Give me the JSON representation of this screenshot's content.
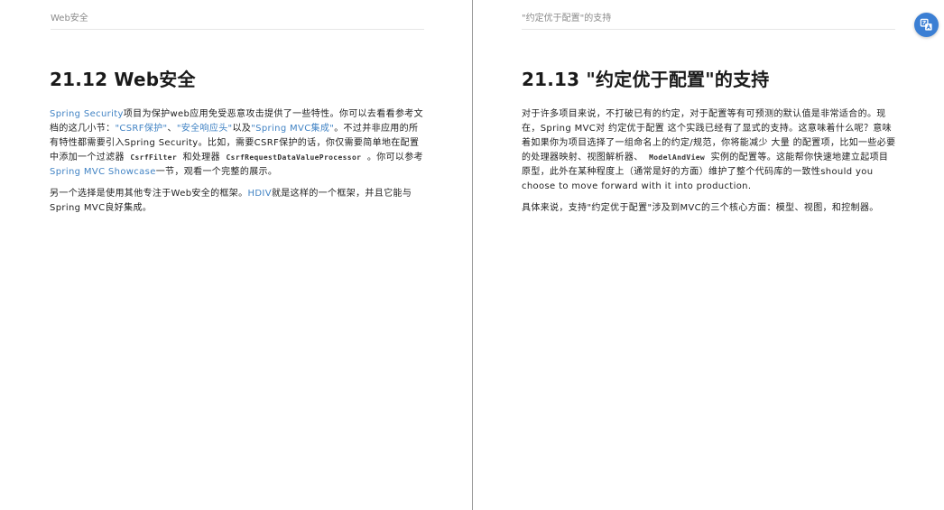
{
  "left_page": {
    "running_head": "Web安全",
    "title": "21.12 Web安全",
    "p1": {
      "link_spring_security": "Spring Security",
      "t1": "项目为保护web应用免受恶意攻击提供了一些特性。你可以去看看参考文档的这几小节：",
      "link_csrf": "\"CSRF保护\"",
      "t2": "、",
      "link_headers": "\"安全响应头\"",
      "t3": "以及",
      "link_mvc_integration": "\"Spring MVC集成\"",
      "t4": "。不过并非应用的所有特性都需要引入Spring Security。比如，需要CSRF保护的话，你仅需要简单地在配置中添加一个过滤器 ",
      "code_filter": "CsrfFilter",
      "t5": " 和处理器 ",
      "code_processor": "CsrfRequestDataValueProcessor",
      "t6": " 。你可以参考",
      "link_showcase": "Spring MVC Showcase",
      "t7": "一节，观看一个完整的展示。"
    },
    "p2": {
      "t1": "另一个选择是使用其他专注于Web安全的框架。",
      "link_hdiv": "HDIV",
      "t2": "就是这样的一个框架，并且它能与Spring MVC良好集成。"
    }
  },
  "right_page": {
    "running_head": "\"约定优于配置\"的支持",
    "title": "21.13 \"约定优于配置\"的支持",
    "p1": {
      "t1": "对于许多项目来说，不打破已有的约定，对于配置等有可预测的默认值是非常适合的。现在，Spring MVC对 约定优于配置 这个实践已经有了显式的支持。这意味着什么呢？意味着如果你为项目选择了一组命名上的约定/规范，你将能减少 大量 的配置项，比如一些必要的处理器映射、视图解析器、 ",
      "code_mav": "ModelAndView",
      "t2": " 实例的配置等。这能帮你快速地建立起项目原型，此外在某种程度上（通常是好的方面）维护了整个代码库的一致性should you choose to move forward with it into production."
    },
    "p2": {
      "t1": "具体来说，支持\"约定优于配置\"涉及到MVC的三个核心方面：模型、视图，和控制器。"
    }
  },
  "fab": {
    "icon": "translate-icon",
    "color": "#3b7fd4"
  }
}
